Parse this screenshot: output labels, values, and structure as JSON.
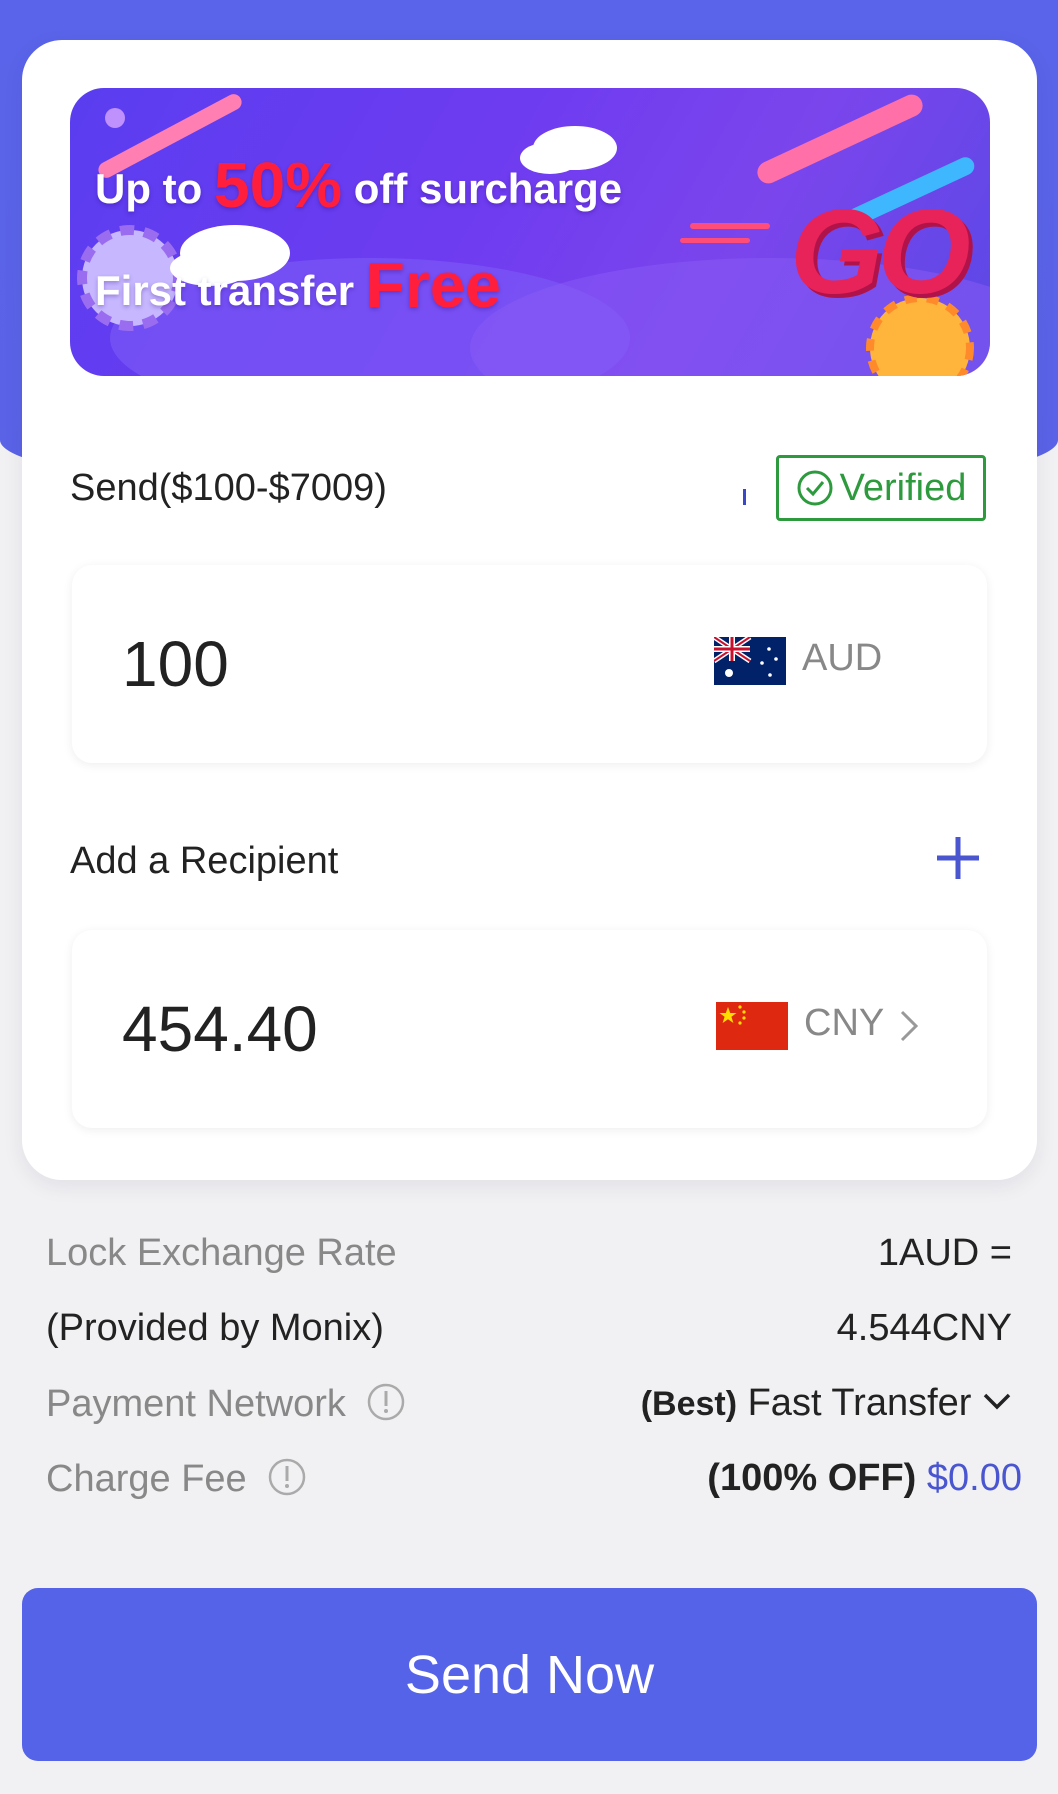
{
  "banner": {
    "line1_prefix": "Up to",
    "line1_highlight": "50%",
    "line1_suffix": "off surcharge",
    "line2_prefix": "First transfer",
    "line2_highlight": "Free",
    "go_text": "GO"
  },
  "send": {
    "label": "Send($100-$7009)",
    "verified_label": "Verified",
    "amount": "100",
    "currency": "AUD",
    "flag_icon": "australia-flag-icon"
  },
  "recipient": {
    "label": "Add a Recipient",
    "amount": "454.40",
    "currency": "CNY",
    "flag_icon": "china-flag-icon"
  },
  "details": {
    "lock_rate_label": "Lock Exchange Rate",
    "lock_rate_value": "1AUD =",
    "provider_label": "(Provided by Monix)",
    "provider_value": "4.544CNY",
    "network_label": "Payment Network",
    "network_badge": "(Best)",
    "network_value": "Fast Transfer",
    "fee_label": "Charge Fee",
    "fee_badge": "(100% OFF)",
    "fee_value": "$0.00"
  },
  "actions": {
    "send_now": "Send Now"
  },
  "colors": {
    "accent": "#5563e8",
    "verified": "#2e9a3e",
    "fee_value": "#4a56d0",
    "promo_red": "#ff1f3d"
  }
}
